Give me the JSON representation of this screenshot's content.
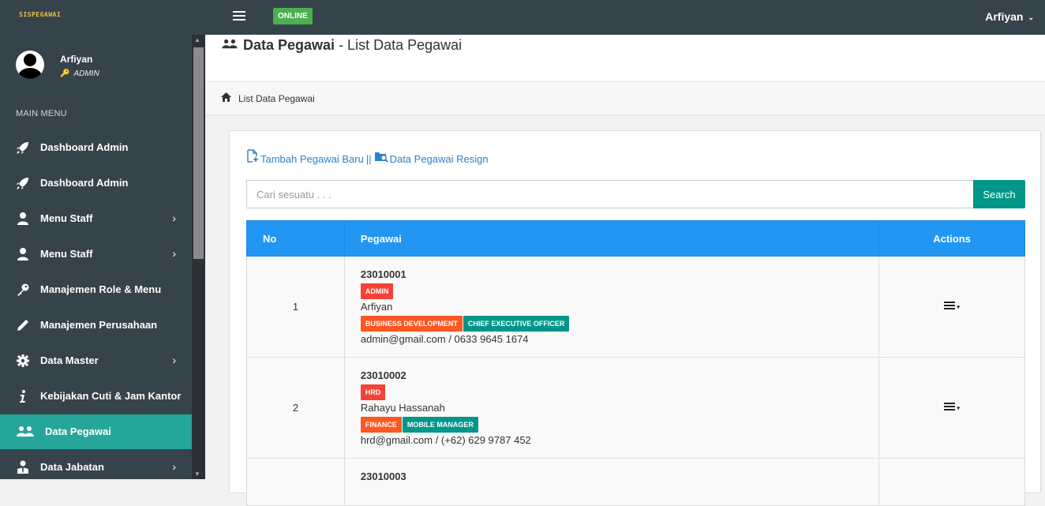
{
  "app": {
    "logo": "SISPEGAWAI",
    "status": "ONLINE",
    "user": "Arfiyan"
  },
  "profile": {
    "name": "Arfiyan",
    "role": "ADMIN"
  },
  "sidebar": {
    "header": "MAIN MENU",
    "items": [
      {
        "label": "Dashboard Admin",
        "icon": "rocket-icon",
        "chevron": false
      },
      {
        "label": "Dashboard Admin",
        "icon": "rocket-icon",
        "chevron": false
      },
      {
        "label": "Menu Staff",
        "icon": "user-icon",
        "chevron": true
      },
      {
        "label": "Menu Staff",
        "icon": "user-icon",
        "chevron": true
      },
      {
        "label": "Manajemen Role & Menu",
        "icon": "key-icon",
        "chevron": false
      },
      {
        "label": "Manajemen Perusahaan",
        "icon": "pencil-icon",
        "chevron": false
      },
      {
        "label": "Data Master",
        "icon": "gear-icon",
        "chevron": true
      },
      {
        "label": "Kebijakan Cuti & Jam Kantor",
        "icon": "info-icon",
        "chevron": false
      },
      {
        "label": "Data Pegawai",
        "icon": "users-icon",
        "chevron": false,
        "active": true
      },
      {
        "label": "Data Jabatan",
        "icon": "user-tie-icon",
        "chevron": true
      }
    ]
  },
  "page": {
    "title_bold": "Data Pegawai",
    "title_rest": " - List Data Pegawai",
    "breadcrumb": "List Data Pegawai"
  },
  "actions": {
    "add_link": "Tambah Pegawai Baru",
    "separator": "||",
    "resign_link": "Data Pegawai Resign"
  },
  "search": {
    "placeholder": "Cari sesuatu . . .",
    "button": "Search"
  },
  "table": {
    "headers": {
      "no": "No",
      "pegawai": "Pegawai",
      "actions": "Actions"
    },
    "rows": [
      {
        "no": "1",
        "id": "23010001",
        "role": "ADMIN",
        "name": "Arfiyan",
        "dept": "BUSINESS DEVELOPMENT",
        "position": "CHIEF EXECUTIVE OFFICER",
        "contact": "admin@gmail.com / 0633 9645 1674"
      },
      {
        "no": "2",
        "id": "23010002",
        "role": "HRD",
        "name": "Rahayu Hassanah",
        "dept": "FINANCE",
        "position": "MOBILE MANAGER",
        "contact": "hrd@gmail.com / (+62) 629 9787 452"
      },
      {
        "no": "",
        "id": "23010003",
        "role": "",
        "name": "",
        "dept": "",
        "position": "",
        "contact": ""
      }
    ]
  },
  "colors": {
    "sidebar": "#37434b",
    "active": "#26a69a",
    "table_header": "#2196f3",
    "search_button": "#009688",
    "badge_red": "#f44336",
    "badge_orange": "#ff5722",
    "badge_teal": "#009688"
  }
}
